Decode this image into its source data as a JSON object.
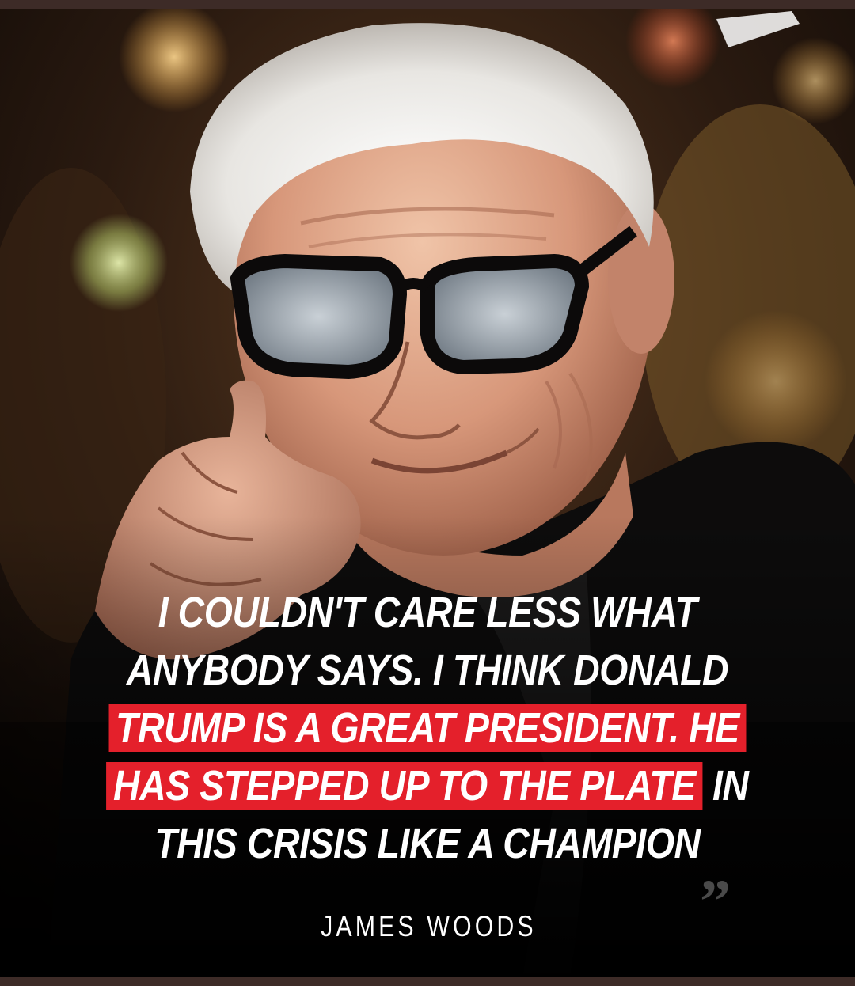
{
  "quote": {
    "line1": "I COULDN'T CARE LESS WHAT",
    "line2": "ANYBODY SAYS. I THINK DONALD",
    "line3_highlight": "TRUMP IS A GREAT PRESIDENT. HE",
    "line4_highlight": "HAS STEPPED UP TO THE PLATE",
    "line4_rest": " IN",
    "line5": "THIS CRISIS LIKE A CHAMPION",
    "highlight_color": "#e4202b",
    "text_color": "#ffffff"
  },
  "quote_mark": {
    "glyph": "”",
    "icon": "closing-quote-icon"
  },
  "attribution": "JAMES WOODS",
  "photo": {
    "subject": "man-with-glasses-pointing-photo"
  },
  "colors": {
    "frame": "#3d2b27",
    "background": "#0a0705"
  }
}
